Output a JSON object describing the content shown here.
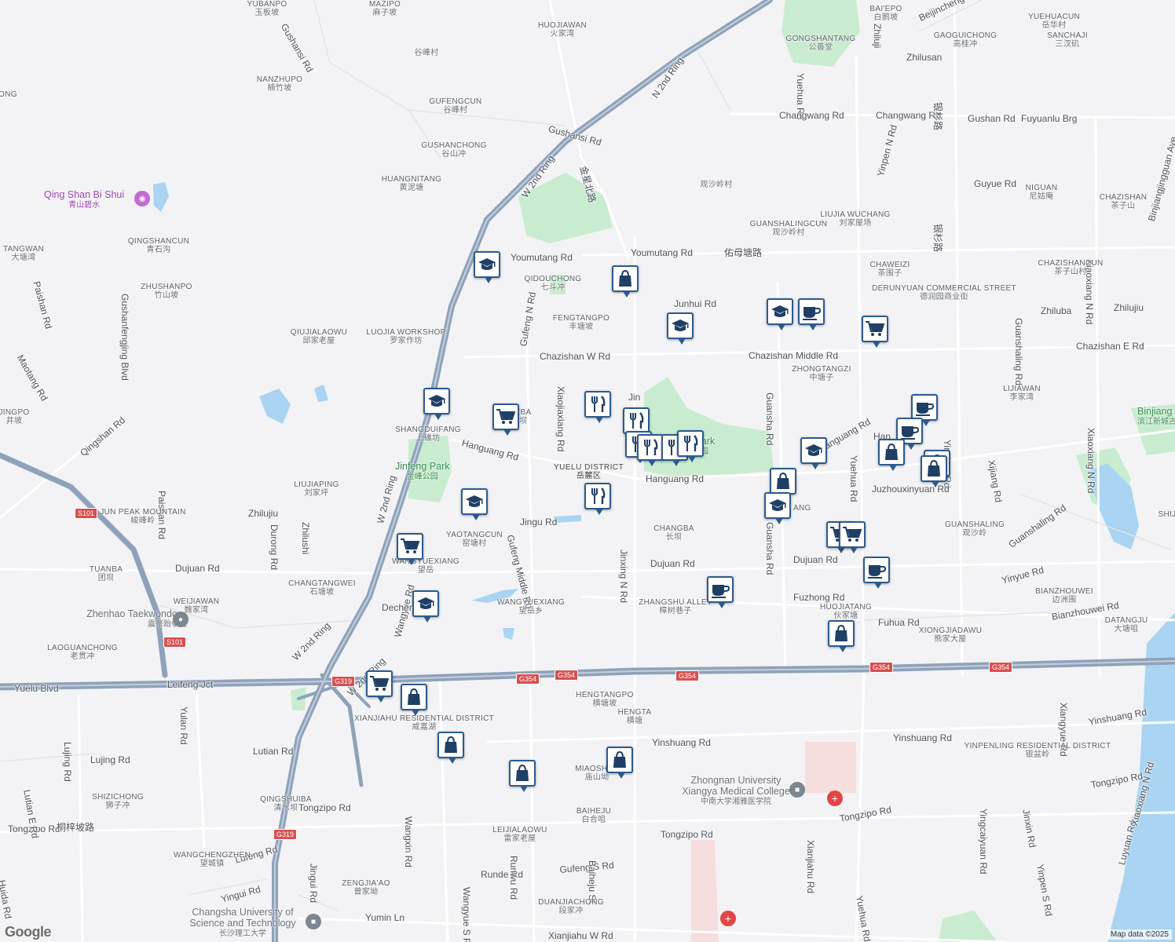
{
  "map": {
    "attribution": "Map data ©2025",
    "logo": "Google",
    "colors": {
      "background": "#f3f3f5",
      "park": "#c9ecd0",
      "water": "#a9d4f2",
      "highway": "#8fa2bb",
      "major_road": "#ffffff",
      "marker_border": "#2c5a8f",
      "marker_icon": "#1f3f66",
      "route_shield": "#d84f4f",
      "hospital": "#e04646",
      "school_icon": "#7d8790",
      "tourist_icon": "#c26ad4"
    }
  },
  "roads": [
    {
      "text": "Gushansi Rd"
    },
    {
      "text": "Gushansi Rd"
    },
    {
      "text": "N 2nd Ring"
    },
    {
      "text": "W 2nd Ring"
    },
    {
      "text": "金星北路"
    },
    {
      "text": "Youmutang Rd"
    },
    {
      "text": "Youmutang Rd"
    },
    {
      "text": "佑母塘路"
    },
    {
      "text": "Junhui Rd"
    },
    {
      "text": "Chazishan W Rd"
    },
    {
      "text": "Chazishan Middle Rd"
    },
    {
      "text": "Chazishan E Rd"
    },
    {
      "text": "Gufeng N Rd"
    },
    {
      "text": "Xiaojiaxiang Rd"
    },
    {
      "text": "Hanguang Rd"
    },
    {
      "text": "Hanguang Rd"
    },
    {
      "text": "Hanguang Rd"
    },
    {
      "text": "Jingu Rd"
    },
    {
      "text": "Gufeng Middle Rd"
    },
    {
      "text": "Dujuan Rd"
    },
    {
      "text": "Dujuan Rd"
    },
    {
      "text": "Dujuan Rd"
    },
    {
      "text": "Jinxing N Rd"
    },
    {
      "text": "Guansha Rd"
    },
    {
      "text": "Guansha Rd"
    },
    {
      "text": "Fuzhong Rd"
    },
    {
      "text": "Fuhua Rd"
    },
    {
      "text": "Yuehua Rd"
    },
    {
      "text": "Yuehua Rd"
    },
    {
      "text": "Yinpen N Rd"
    },
    {
      "text": "Changwang Rd"
    },
    {
      "text": "Changwang Rd"
    },
    {
      "text": "Gushan Rd"
    },
    {
      "text": "Fuyuanlu Brg"
    },
    {
      "text": "Zhilusan"
    },
    {
      "text": "Beijincheng Rd"
    },
    {
      "text": "Zhiluji"
    },
    {
      "text": "银杉路"
    },
    {
      "text": "银杉路"
    },
    {
      "text": "Guyue Rd"
    },
    {
      "text": "Yinshan Rd"
    },
    {
      "text": "Guanshaling Rd"
    },
    {
      "text": "Guanshaling Rd"
    },
    {
      "text": "Zhiluba"
    },
    {
      "text": "Zhilujiu"
    },
    {
      "text": "Xiaoxiang N Rd"
    },
    {
      "text": "Xiaoxiang N Rd"
    },
    {
      "text": "Binjiangjingguan Ave"
    },
    {
      "text": "Juzhouxinyuan Rd"
    },
    {
      "text": "Yinyue Rd"
    },
    {
      "text": "Bianzhouwei Rd"
    },
    {
      "text": "Xijiang Rd"
    },
    {
      "text": "Yinshuang Rd"
    },
    {
      "text": "Yinshuang Rd"
    },
    {
      "text": "Yinshuang Rd"
    },
    {
      "text": "Tongzipo Rd"
    },
    {
      "text": "Tongzipo Rd"
    },
    {
      "text": "Tongzipo Rd"
    },
    {
      "text": "Tongzipo Rd"
    },
    {
      "text": "Tongzipo Rd"
    },
    {
      "text": "桐梓坡路"
    },
    {
      "text": "Xiangyue Rd"
    },
    {
      "text": "Leifeng Jct"
    },
    {
      "text": "Yuelu Blvd"
    },
    {
      "text": "Qingshan Rd"
    },
    {
      "text": "Paishan Rd"
    },
    {
      "text": "Paishan Rd"
    },
    {
      "text": "Gushanfengjing Blvd"
    },
    {
      "text": "Maotang Rd"
    },
    {
      "text": "Zhilujiu"
    },
    {
      "text": "Zhilushi"
    },
    {
      "text": "Durong Rd"
    },
    {
      "text": "Wangyue Rd"
    },
    {
      "text": "W 2nd Ring"
    },
    {
      "text": "W 2nd Ring"
    },
    {
      "text": "W 2nd Ring"
    },
    {
      "text": "Yulan Rd"
    },
    {
      "text": "Lujing Rd"
    },
    {
      "text": "Lujing Rd"
    },
    {
      "text": "Lutian Rd"
    },
    {
      "text": "Lutian E Rd"
    },
    {
      "text": "Huida Rd"
    },
    {
      "text": "Lufeng Rd"
    },
    {
      "text": "Yingui Rd"
    },
    {
      "text": "Jingui Rd"
    },
    {
      "text": "Wangxin Rd"
    },
    {
      "text": "Wangyue S Rd"
    },
    {
      "text": "Runde Rd"
    },
    {
      "text": "Runwu Rd"
    },
    {
      "text": "Gufeng S Rd"
    },
    {
      "text": "Baiheju St"
    },
    {
      "text": "Yumin Ln"
    },
    {
      "text": "Xianjiahu W Rd"
    },
    {
      "text": "Xianjiahu Rd"
    },
    {
      "text": "Yuehua Rd"
    },
    {
      "text": "Yingcaiyuan Rd"
    },
    {
      "text": "Jinxin Rd"
    },
    {
      "text": "Yinpen S Rd"
    },
    {
      "text": "Luyuan Rd"
    },
    {
      "text": "Xiaoxiang N Rd"
    },
    {
      "text": "Xiaoxiang N Rd"
    }
  ],
  "places": [
    {
      "en": "YUBANPO",
      "zh": "玉板坡"
    },
    {
      "en": "MAZIPO",
      "zh": "麻子坡"
    },
    {
      "en": "HUOJIAWAN",
      "zh": "火家湾"
    },
    {
      "en": "",
      "zh": "谷峰村"
    },
    {
      "en": "NANZHUPO",
      "zh": "楠竹坡"
    },
    {
      "en": "GUFENGCUN",
      "zh": "谷峰村"
    },
    {
      "en": "GUSHANCHONG",
      "zh": "谷山冲"
    },
    {
      "en": "HUANGNITANG",
      "zh": "黄泥塘"
    },
    {
      "en": "QINGSHANCUN",
      "zh": "青石沟"
    },
    {
      "en": "ZHUSHANPO",
      "zh": "竹山坡"
    },
    {
      "en": "QIUJIALAOWU",
      "zh": "邱家老屋"
    },
    {
      "en": "LUOJIA WORKSHOP",
      "zh": "罗家作坊"
    },
    {
      "en": "QIDOUCHONG",
      "zh": "七斗冲"
    },
    {
      "en": "FENGTANGPO",
      "zh": "丰塘坡"
    },
    {
      "en": "",
      "zh": "观沙岭村"
    },
    {
      "en": "GUANSHALINGCUN",
      "zh": "观沙岭村"
    },
    {
      "en": "LIUJIA WUCHANG",
      "zh": "刘家屋场"
    },
    {
      "en": "GONGSHANTANG",
      "zh": "公善堂"
    },
    {
      "en": "BAI'EPO",
      "zh": "白鹅坡"
    },
    {
      "en": "GAOGUICHONG",
      "zh": "高桂冲"
    },
    {
      "en": "YUEHUACUN",
      "zh": "岳华村"
    },
    {
      "en": "SANCHAJI",
      "zh": "三汊矶"
    },
    {
      "en": "NIGUAN",
      "zh": "尼姑庵"
    },
    {
      "en": "CHAZISHAN",
      "zh": "茶子山"
    },
    {
      "en": "CHAWEIZI",
      "zh": "茶围子"
    },
    {
      "en": "DERUNYUAN COMMERCIAL STREET",
      "zh": "德润园商业街"
    },
    {
      "en": "CHAZISHANCUN",
      "zh": "茶子山村"
    },
    {
      "en": "ZHONGTANGZI",
      "zh": "中塘子"
    },
    {
      "en": "LIJIAWAN",
      "zh": "李家湾"
    },
    {
      "en": "XIEBA",
      "zh": "斜坝"
    },
    {
      "en": "SHANGDUIFANG",
      "zh": "上碓坊"
    },
    {
      "en": "LIUJIAPING",
      "zh": "刘家坪"
    },
    {
      "en": "JUN PEAK MOUNTAIN",
      "zh": "峻峰岭"
    },
    {
      "en": "TUANBA",
      "zh": "团坝"
    },
    {
      "en": "YAOTANGCUN",
      "zh": "窑塘村"
    },
    {
      "en": "WANGYUEXIANG",
      "zh": "望岳"
    },
    {
      "en": "CHANGTANGWEI",
      "zh": "石塘坡"
    },
    {
      "en": "WEIJIAWAN",
      "zh": "魏家湾"
    },
    {
      "en": "WANGYUEXIANG",
      "zh": "望岳乡"
    },
    {
      "en": "CHANGBA",
      "zh": "长坝"
    },
    {
      "en": "ZHANGSHU ALLEY",
      "zh": "樟树巷子"
    },
    {
      "en": "HUOJIATANG",
      "zh": "伙家塘"
    },
    {
      "en": "XIONGJIADAWU",
      "zh": "熊家大屋"
    },
    {
      "en": "BIANZHOUWEI",
      "zh": "边洲围"
    },
    {
      "en": "DATANGJU",
      "zh": "大塘咀"
    },
    {
      "en": "GUANSHALING",
      "zh": "观沙岭"
    },
    {
      "en": "LAOGUANCHONG",
      "zh": "老贯冲"
    },
    {
      "en": "HENGTANGPO",
      "zh": "横塘坡"
    },
    {
      "en": "HENGTA",
      "zh": "横塘"
    },
    {
      "en": "XIANJIAHU RESIDENTIAL DISTRICT",
      "zh": "咸嘉湖"
    },
    {
      "en": "MIAOSHAN",
      "zh": "庙山坳"
    },
    {
      "en": "BAIHEJU",
      "zh": "白合咀"
    },
    {
      "en": "LEIJIALAOWU",
      "zh": "雷家老屋"
    },
    {
      "en": "ZENGJIA'AO",
      "zh": "曾家坳"
    },
    {
      "en": "DUANJIACHONG",
      "zh": "段家冲"
    },
    {
      "en": "SHIZICHONG",
      "zh": "狮子冲"
    },
    {
      "en": "QINGSHUIBA",
      "zh": "清水坝"
    },
    {
      "en": "WANGCHENGZHEN",
      "zh": "望城镇"
    },
    {
      "en": "YINPENLING RESIDENTIAL DISTRICT",
      "zh": "银盆岭"
    },
    {
      "en": "JINGPO",
      "zh": "井坡"
    },
    {
      "en": "TANGWAN",
      "zh": "大塘湾"
    },
    {
      "en": "ONG",
      "zh": ""
    },
    {
      "en": "SHIJ",
      "zh": ""
    }
  ],
  "district": {
    "en": "YUELU DISTRICT",
    "zh": "岳麓区"
  },
  "parks": [
    {
      "en": "Jinfeng Park",
      "zh": "金峰公园"
    },
    {
      "en": "g Park",
      "zh": "公园"
    },
    {
      "en": "Binjiang Xinche Guzhang P",
      "zh": "滨江新城古樟公园"
    }
  ],
  "pois": [
    {
      "en": "Qing Shan Bi Shui",
      "zh": "青山碧水",
      "kind": "tourist"
    },
    {
      "en": "Zhenhao Taekwondo",
      "zh": "震豪跆拳道",
      "kind": "gym"
    },
    {
      "en": "Zhongnan University Xiangya Medical College",
      "zh": "中南大学湘雅医学院",
      "kind": "school"
    },
    {
      "en": "Changsha University of Science and Technology",
      "zh": "长沙理工大学",
      "kind": "school"
    },
    {
      "en": "Dechen",
      "zh": "",
      "kind": "school"
    },
    {
      "en": "Han",
      "zh": "",
      "kind": "road"
    },
    {
      "en": "ANG",
      "zh": "",
      "kind": "place"
    },
    {
      "en": "Jin",
      "zh": "",
      "kind": "road"
    }
  ],
  "shields": [
    "S101",
    "S101",
    "G319",
    "G354",
    "G354",
    "G354",
    "G354",
    "G354",
    "G319"
  ],
  "markers": [
    {
      "type": "school"
    },
    {
      "type": "shopping"
    },
    {
      "type": "school"
    },
    {
      "type": "school"
    },
    {
      "type": "coffee"
    },
    {
      "type": "grocery"
    },
    {
      "type": "school"
    },
    {
      "type": "grocery"
    },
    {
      "type": "restaurant"
    },
    {
      "type": "restaurant"
    },
    {
      "type": "restaurant"
    },
    {
      "type": "restaurant"
    },
    {
      "type": "restaurant"
    },
    {
      "type": "restaurant"
    },
    {
      "type": "school"
    },
    {
      "type": "coffee"
    },
    {
      "type": "coffee"
    },
    {
      "type": "shopping"
    },
    {
      "type": "shopping"
    },
    {
      "type": "shopping"
    },
    {
      "type": "restaurant"
    },
    {
      "type": "school"
    },
    {
      "type": "school"
    },
    {
      "type": "shopping"
    },
    {
      "type": "grocery"
    },
    {
      "type": "grocery"
    },
    {
      "type": "coffee"
    },
    {
      "type": "coffee"
    },
    {
      "type": "school"
    },
    {
      "type": "shopping"
    },
    {
      "type": "grocery"
    },
    {
      "type": "shopping"
    },
    {
      "type": "grocery"
    },
    {
      "type": "shopping"
    },
    {
      "type": "shopping"
    },
    {
      "type": "shopping"
    }
  ]
}
